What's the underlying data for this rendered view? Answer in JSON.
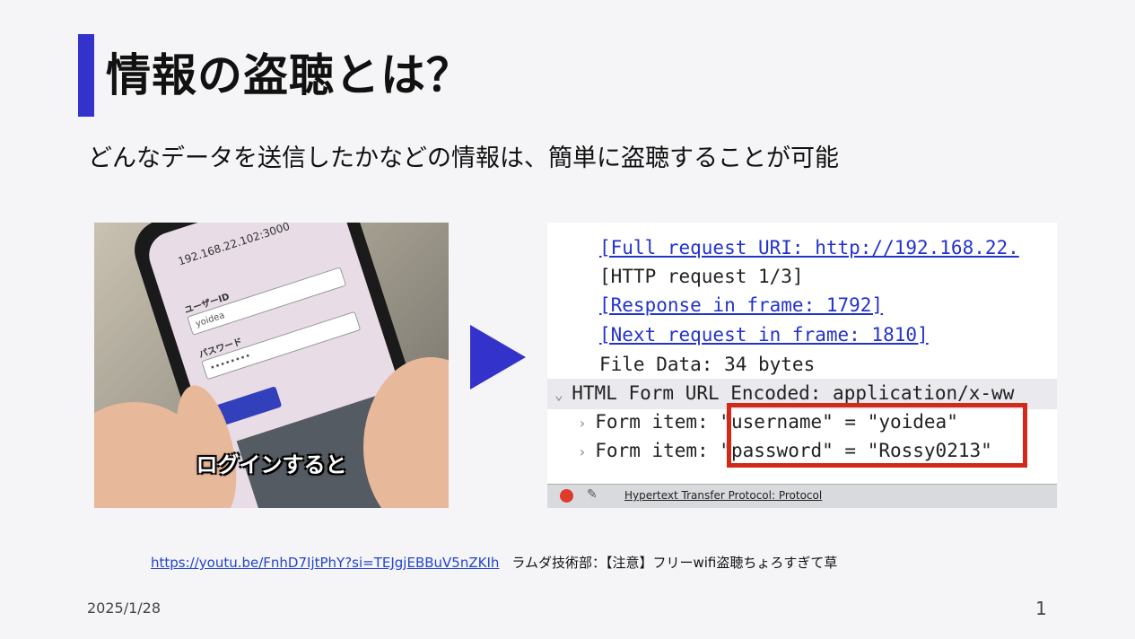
{
  "slide": {
    "title": "情報の盗聴とは？",
    "subtitle": "どんなデータを送信したかなどの情報は、簡単に盗聴することが可能",
    "date": "2025/1/28",
    "page_number": "1",
    "accent_color": "#3333cc"
  },
  "photo": {
    "caption": "ログインすると",
    "phone_url": "192.168.22.102:3000",
    "userid_label": "ユーザーID",
    "userid_value": "yoidea",
    "password_label": "パスワード",
    "password_value": "••••••••"
  },
  "capture": {
    "lines": [
      "[Full request URI: http://192.168.22.",
      "[HTTP request 1/3]",
      "[Response in frame: 1792]",
      "[Next request in frame: 1810]",
      "File Data: 34 bytes",
      "HTML Form URL Encoded: application/x-ww",
      "Form item: \"username\" = \"yoidea\"",
      "Form item: \"password\" = \"Rossy0213\""
    ],
    "status_text": "Hypertext Transfer Protocol: Protocol",
    "highlight_color": "#d22a1a"
  },
  "source": {
    "url": "https://youtu.be/FnhD7IjtPhY?si=TEJgjEBBuV5nZKIh",
    "label": "ラムダ技術部：【注意】フリーwifi盗聴ちょろすぎて草"
  }
}
